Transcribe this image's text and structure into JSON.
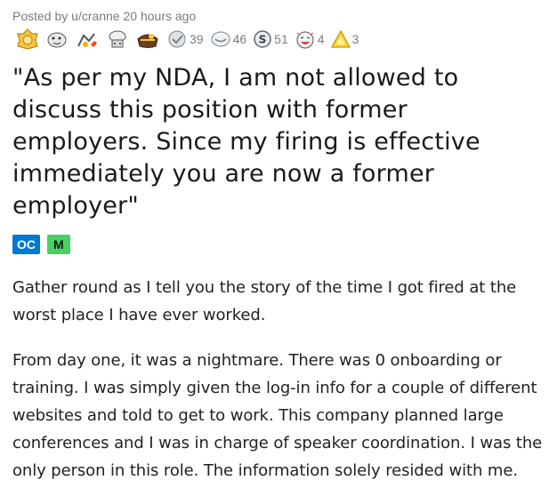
{
  "post": {
    "meta": "Posted by u/cranne 20 hours ago",
    "awards": [
      {
        "icon": "gold-medal-icon",
        "count": ""
      },
      {
        "icon": "wholesome-seal-icon",
        "count": ""
      },
      {
        "icon": "hand-heart-icon",
        "count": ""
      },
      {
        "icon": "chef-hat-icon",
        "count": ""
      },
      {
        "icon": "treasure-icon",
        "count": ""
      },
      {
        "icon": "silver-medal-icon",
        "count": "39"
      },
      {
        "icon": "helpful-icon",
        "count": "46"
      },
      {
        "icon": "coin-s-icon",
        "count": "51"
      },
      {
        "icon": "laughing-face-icon",
        "count": "4"
      },
      {
        "icon": "gold-triangle-icon",
        "count": "3"
      }
    ],
    "title": "\"As per my NDA, I am not allowed to discuss this position with former employers. Since my firing is effective immediately you are now a former employer\"",
    "flairs": {
      "oc": "OC",
      "m": "M"
    },
    "paragraphs": [
      "Gather round as I tell you the story of the time I got fired at the worst place I have ever worked.",
      "From day one, it was a nightmare. There was 0 onboarding or training. I was simply given the log-in info for a couple of different websites and told to get to work. This company planned large conferences and I was in charge of speaker coordination. I was the only person in this role. The information solely resided with me."
    ]
  }
}
